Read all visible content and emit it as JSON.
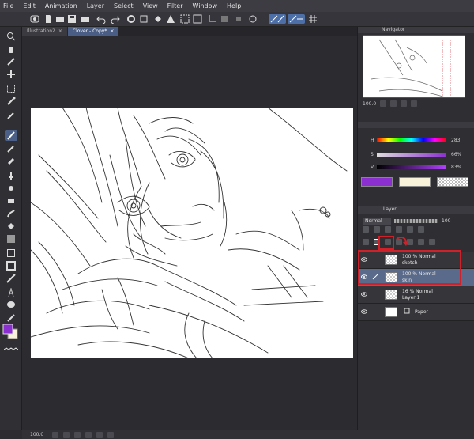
{
  "menu": [
    "File",
    "Edit",
    "Animation",
    "Layer",
    "Select",
    "View",
    "Filter",
    "Window",
    "Help"
  ],
  "tabs": [
    {
      "label": "Illustration2"
    },
    {
      "label": "Clover - Copy*"
    }
  ],
  "navigator": {
    "title": "Navigator",
    "zoom": "100.0"
  },
  "color": {
    "h_label": "H",
    "h_value": "283",
    "s_label": "S",
    "s_value": "66%",
    "v_label": "V",
    "v_value": "83%",
    "main_color": "#8b2fd0",
    "sub_color": "#f7f2d9"
  },
  "layer_panel": {
    "title": "Layer",
    "blend_mode": "Normal",
    "opacity": "100",
    "layers": [
      {
        "line1": "100 % Normal",
        "line2": "sketch",
        "selected": false
      },
      {
        "line1": "100 % Normal",
        "line2": "skin",
        "selected": true
      },
      {
        "line1": "16 % Normal",
        "line2": "Layer 1",
        "selected": false
      },
      {
        "line1": "Paper",
        "line2": "",
        "selected": false
      }
    ]
  },
  "status": {
    "zoom": "100.0"
  }
}
